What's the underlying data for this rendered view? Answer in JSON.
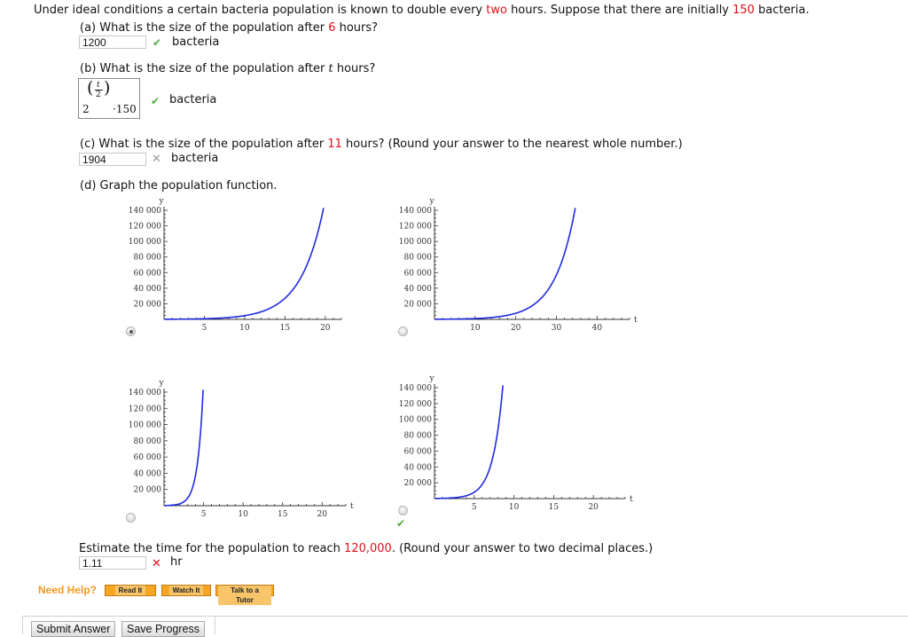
{
  "problem": {
    "intro_pre": "Under ideal conditions a certain bacteria population is known to double every ",
    "doubling_period": "two",
    "intro_mid": " hours. Suppose that there are initially ",
    "initial_count": "150",
    "intro_post": " bacteria."
  },
  "part_a": {
    "q_pre": "(a) What is the size of the population after ",
    "hours": "6",
    "q_post": " hours?",
    "answer": "1200",
    "status": "correct",
    "status_icon": "check-icon",
    "unit": "bacteria"
  },
  "part_b": {
    "q_pre": "(b) What is the size of the population after ",
    "var": "t",
    "q_post": " hours?",
    "answer_base": "2",
    "answer_exp_num": "t",
    "answer_exp_den": "2",
    "answer_factor": "·150",
    "status": "correct",
    "status_icon": "check-icon",
    "unit": "bacteria"
  },
  "part_c": {
    "q_pre": "(c) What is the size of the population after ",
    "hours": "11",
    "q_post": " hours? (Round your answer to the nearest whole number.)",
    "answer": "1904",
    "status": "incorrect",
    "status_icon": "x-icon",
    "unit": "bacteria"
  },
  "part_d": {
    "q": "(d) Graph the population function.",
    "selected_option": 0,
    "status": "correct",
    "status_icon": "check-icon",
    "graphs": [
      {
        "y_label": "y",
        "x_label": "t",
        "y_ticks": [
          "140000",
          "120000",
          "100000",
          "80000",
          "60000",
          "40000",
          "20000"
        ],
        "x_ticks": [
          "5",
          "10",
          "15",
          "20"
        ],
        "x_max": 22,
        "doubling_hours": 2,
        "selected": true
      },
      {
        "y_label": "y",
        "x_label": "t",
        "y_ticks": [
          "140000",
          "120000",
          "100000",
          "80000",
          "60000",
          "40000",
          "20000"
        ],
        "x_ticks": [
          "10",
          "20",
          "30",
          "40"
        ],
        "x_max": 48,
        "doubling_hours": 3.5,
        "selected": false
      },
      {
        "y_label": "y",
        "x_label": "t",
        "y_ticks": [
          "140000",
          "120000",
          "100000",
          "80000",
          "60000",
          "40000",
          "20000"
        ],
        "x_ticks": [
          "5",
          "10",
          "15",
          "20"
        ],
        "x_max": 23,
        "doubling_hours": 0.5,
        "selected": false
      },
      {
        "y_label": "y",
        "x_label": "t",
        "y_ticks": [
          "140000",
          "120000",
          "100000",
          "80000",
          "60000",
          "40000",
          "20000"
        ],
        "x_ticks": [
          "5",
          "10",
          "15",
          "20"
        ],
        "x_max": 24,
        "doubling_hours": 0.87,
        "selected": false
      }
    ]
  },
  "part_e": {
    "q_pre": "Estimate the time for the population to reach ",
    "target": "120,000",
    "q_post": ". (Round your answer to two decimal places.)",
    "answer": "1.11",
    "status": "incorrect",
    "status_icon": "x-icon",
    "unit": "hr"
  },
  "help": {
    "label": "Need Help?",
    "buttons": [
      "Read It",
      "Watch It",
      "Talk to a Tutor"
    ]
  },
  "footer": {
    "submit_label": "Submit Answer",
    "save_label": "Save Progress"
  },
  "colors": {
    "highlight": "#e0101b",
    "curve": "#1f2be0",
    "correct": "#4fae3c",
    "help": "#f39a22"
  }
}
